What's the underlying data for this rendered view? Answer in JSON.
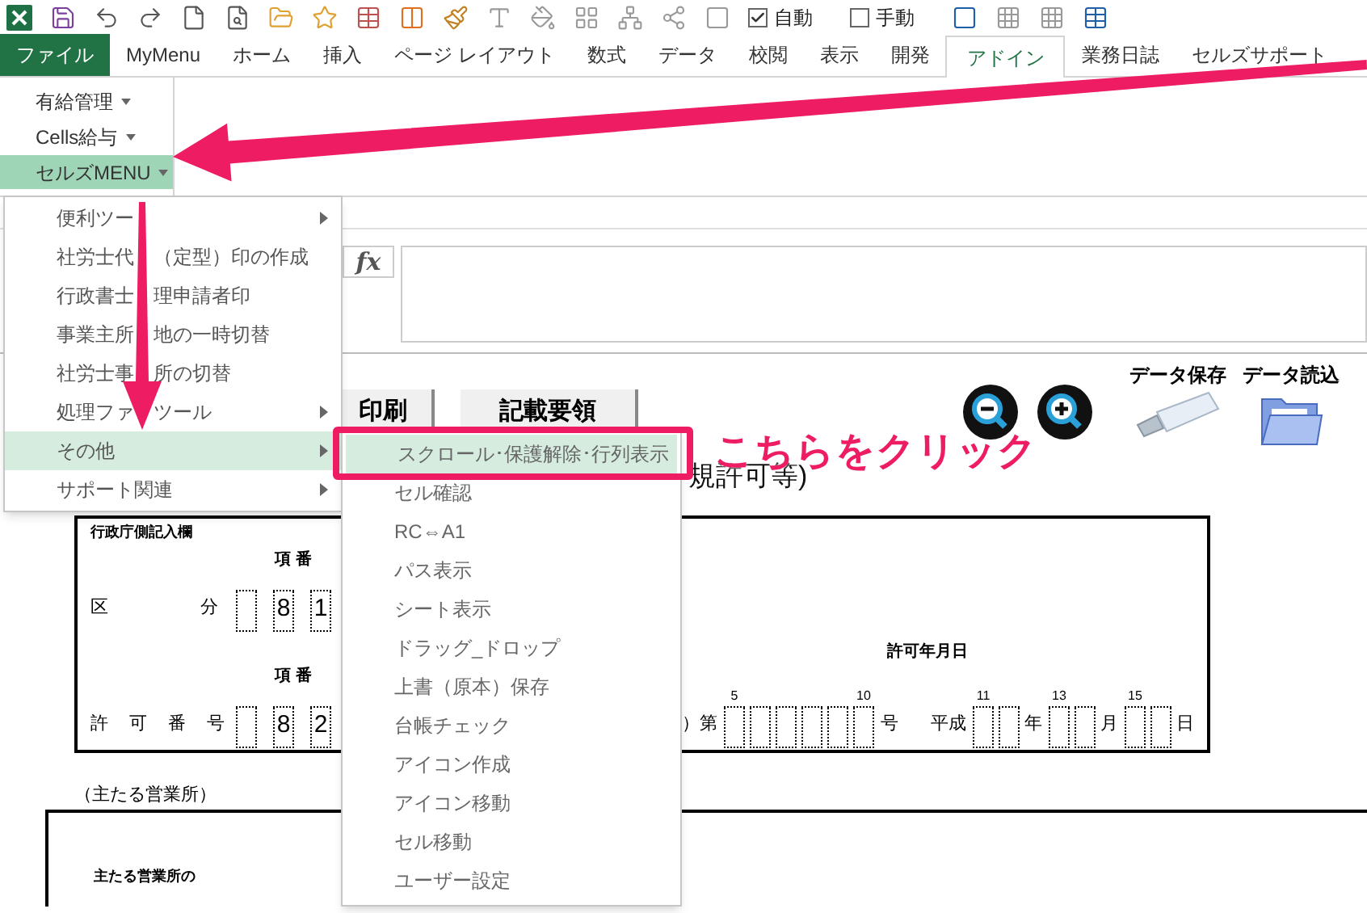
{
  "quick_access": {
    "auto": {
      "label": "自動",
      "checked": true
    },
    "manual": {
      "label": "手動",
      "checked": false
    }
  },
  "tabs": [
    {
      "label": "ファイル",
      "kind": "file",
      "selected": false
    },
    {
      "label": "MyMenu",
      "kind": "normal",
      "selected": false
    },
    {
      "label": "ホーム",
      "kind": "normal",
      "selected": false
    },
    {
      "label": "挿入",
      "kind": "normal",
      "selected": false
    },
    {
      "label": "ページ レイアウト",
      "kind": "normal",
      "selected": false
    },
    {
      "label": "数式",
      "kind": "normal",
      "selected": false
    },
    {
      "label": "データ",
      "kind": "normal",
      "selected": false
    },
    {
      "label": "校閲",
      "kind": "normal",
      "selected": false
    },
    {
      "label": "表示",
      "kind": "normal",
      "selected": false
    },
    {
      "label": "開発",
      "kind": "normal",
      "selected": false
    },
    {
      "label": "アドイン",
      "kind": "normal",
      "selected": true
    },
    {
      "label": "業務日誌",
      "kind": "normal",
      "selected": false
    },
    {
      "label": "セルズサポート",
      "kind": "normal",
      "selected": false
    }
  ],
  "ribbon_buttons": [
    {
      "label": "有給管理",
      "selected": false
    },
    {
      "label": "Cells給与",
      "selected": false
    },
    {
      "label": "セルズMENU",
      "selected": true
    }
  ],
  "formula_bar": {
    "fx": "fx"
  },
  "sheet": {
    "buttons": [
      "印刷",
      "記載要領"
    ],
    "data_buttons": [
      {
        "label": "データ保存",
        "kind": "save"
      },
      {
        "label": "データ読込",
        "kind": "load"
      }
    ],
    "title": "規許可等)",
    "form": {
      "heading": "行政庁側記入欄",
      "category": {
        "label_start": "区",
        "label_end": "分",
        "caption": "項 番",
        "boxes": [
          {
            "kind": "blank"
          },
          {
            "kind": "digit",
            "value": "8"
          },
          {
            "kind": "digit",
            "value": "1"
          }
        ]
      },
      "permit": {
        "label": "許 可 番 号",
        "caption": "項 番",
        "boxes": [
          {
            "kind": "blank"
          },
          {
            "kind": "digit",
            "value": "8"
          },
          {
            "kind": "digit",
            "value": "2"
          }
        ],
        "prefix": "）第",
        "number_captions": {
          "first": "5",
          "last": "10"
        },
        "suffix": "号"
      },
      "date": {
        "caption": "許可年月日",
        "era": "平成",
        "parts": [
          {
            "unit": "年",
            "caption": "11"
          },
          {
            "unit": "月",
            "caption": "13"
          },
          {
            "unit": "日",
            "caption": "15"
          }
        ]
      }
    },
    "office_heading": "（主たる営業所）",
    "office_label": "主たる営業所の"
  },
  "menu": {
    "items": [
      {
        "label_parts": [
          "便利ツー"
        ],
        "has_submenu": true,
        "selected": false
      },
      {
        "label_parts": [
          "社労士代",
          "（定型）印の作成"
        ],
        "has_submenu": false,
        "selected": false
      },
      {
        "label_parts": [
          "行政書士",
          "理申請者印"
        ],
        "has_submenu": false,
        "selected": false
      },
      {
        "label_parts": [
          "事業主所",
          "地の一時切替"
        ],
        "has_submenu": false,
        "selected": false
      },
      {
        "label_parts": [
          "社労士事",
          "所の切替"
        ],
        "has_submenu": false,
        "selected": false
      },
      {
        "label_parts": [
          "処理ファ",
          "ツール"
        ],
        "has_submenu": true,
        "selected": false
      },
      {
        "label_parts": [
          "その他"
        ],
        "has_submenu": true,
        "selected": true
      },
      {
        "label_parts": [
          "サポート関連"
        ],
        "has_submenu": true,
        "selected": false
      }
    ]
  },
  "submenu": {
    "items": [
      {
        "label": "スクロール･保護解除･行列表示",
        "selected": true
      },
      {
        "label": "セル確認",
        "selected": false
      },
      {
        "label": "RC⇔A1",
        "selected": false
      },
      {
        "label": "パス表示",
        "selected": false
      },
      {
        "label": "シート表示",
        "selected": false
      },
      {
        "label": "ドラッグ_ドロップ",
        "selected": false
      },
      {
        "label": "上書（原本）保存",
        "selected": false
      },
      {
        "label": "台帳チェック",
        "selected": false
      },
      {
        "label": "アイコン作成",
        "selected": false
      },
      {
        "label": "アイコン移動",
        "selected": false
      },
      {
        "label": "セル移動",
        "selected": false
      },
      {
        "label": "ユーザー設定",
        "selected": false
      }
    ]
  },
  "callout": "こちらをクリック"
}
